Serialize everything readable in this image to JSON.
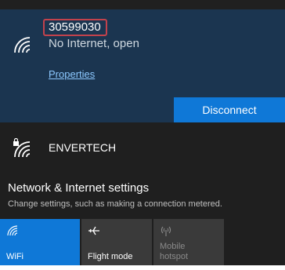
{
  "active_network": {
    "ssid": "30599030",
    "status": "No Internet, open",
    "properties_label": "Properties",
    "disconnect_label": "Disconnect",
    "icon": "wifi-signal-icon"
  },
  "other_network": {
    "ssid": "ENVERTECH",
    "icon": "secured-wifi-icon"
  },
  "settings": {
    "title": "Network & Internet settings",
    "description": "Change settings, such as making a connection metered."
  },
  "quick_actions": {
    "wifi": {
      "label": "WiFi",
      "icon": "wifi-icon",
      "active": true
    },
    "flight": {
      "label": "Flight mode",
      "icon": "airplane-icon",
      "active": false
    },
    "hotspot": {
      "label_line1": "Mobile",
      "label_line2": "hotspot",
      "icon": "hotspot-icon",
      "active": false
    }
  },
  "colors": {
    "accent": "#0f78d7",
    "active_card": "#1b3550",
    "background": "#1f1f1f",
    "ssid_highlight": "#c2424c",
    "link": "#8cc8ff"
  }
}
